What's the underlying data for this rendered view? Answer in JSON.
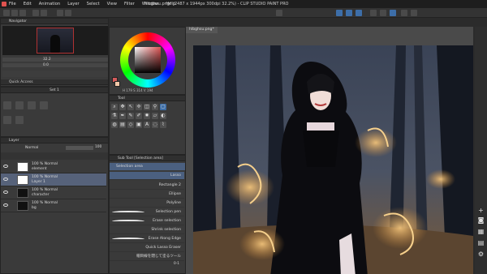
{
  "window": {
    "title": "hlbghsu.png* (2487 x 1944px 300dpi 32.2%) - CLIP STUDIO PAINT PRO"
  },
  "menu": [
    "File",
    "Edit",
    "Animation",
    "Layer",
    "Select",
    "View",
    "Filter",
    "Window",
    "Help"
  ],
  "navigator": {
    "label": "Navigator",
    "zoom": "32.2",
    "rotation": "0.0"
  },
  "quick_access": {
    "label": "Quick Access"
  },
  "subtool_set": {
    "label": "Set 1"
  },
  "color": {
    "main_hex": "#d45b5b",
    "sub_hex": "#f1c7a8",
    "values_label": "H 179  S 314  V 194"
  },
  "tool_palette": {
    "label": "Tool"
  },
  "subtool": {
    "label": "Sub Tool [Selection area]",
    "group": "Selection area",
    "items": [
      "Lasso",
      "Rectangle 2",
      "Ellipse",
      "Polyline",
      "Selection pen",
      "Erase selection",
      "Shrink selection",
      "Erase Along Edge",
      "Quick Lasso Eraser",
      "帽目線を閉じて塗るツール"
    ],
    "page": "0-1"
  },
  "layers": {
    "label": "Layer",
    "blend_mode": "Normal",
    "opacity": "100",
    "rows": [
      {
        "percent": "100 % Normal",
        "name": "element"
      },
      {
        "percent": "100 % Normal",
        "name": "Layer 1"
      },
      {
        "percent": "100 % Normal",
        "name": "character"
      },
      {
        "percent": "100 % Normal",
        "name": "bg"
      }
    ]
  },
  "canvas": {
    "tab_label": "hlbghsu.png*"
  },
  "palette_colors": {
    "accent": "#3d6ea8",
    "selected_layer": "#56627a"
  }
}
